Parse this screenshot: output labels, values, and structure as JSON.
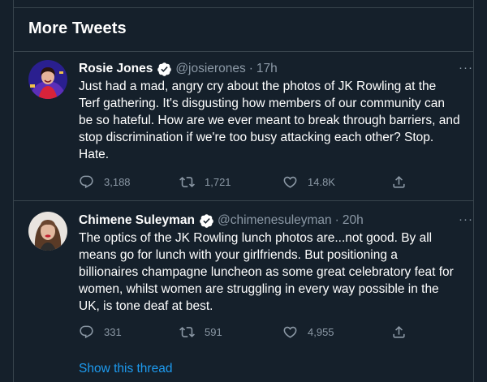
{
  "section": {
    "title": "More Tweets"
  },
  "tweets": [
    {
      "name": "Rosie Jones",
      "handle": "@josierones",
      "time": "17h",
      "more": "···",
      "text": "Just had a mad, angry cry about the photos of JK Rowling at the Terf gathering. It's disgusting how members of our community can be so hateful. How are we ever meant to break through barriers, and stop discrimination if we're too busy attacking each other? Stop. Hate.",
      "replies": "3,188",
      "retweets": "1,721",
      "likes": "14.8K"
    },
    {
      "name": "Chimene Suleyman",
      "handle": "@chimenesuleyman",
      "time": "20h",
      "more": "···",
      "text": "The optics of the JK Rowling lunch photos are...not good. By all means go for lunch with your girlfriends. But positioning a billionaires champagne luncheon as some great celebratory feat for women, whilst women are struggling in every way possible in the UK, is tone deaf at best.",
      "replies": "331",
      "retweets": "591",
      "likes": "4,955"
    }
  ],
  "show_thread": "Show this thread",
  "colors": {
    "background": "#15202b",
    "link": "#1d9bf0",
    "muted": "#8b98a5",
    "verified": "#ffffff"
  }
}
